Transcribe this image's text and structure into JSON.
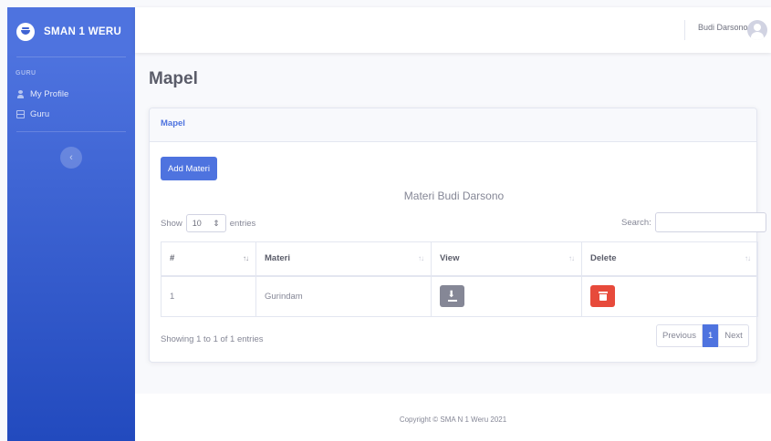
{
  "sidebar": {
    "brand": "SMAN 1 WERU",
    "heading": "GURU",
    "items": [
      {
        "label": "My Profile",
        "icon": "user-icon"
      },
      {
        "label": "Guru",
        "icon": "table-icon"
      }
    ],
    "toggle": "‹",
    "colors": {
      "top": "#4e73df",
      "bottom": "#224abe"
    }
  },
  "topbar": {
    "user_name": "Budi Darsono"
  },
  "page": {
    "title": "Mapel"
  },
  "card": {
    "header": "Mapel",
    "add_button": "Add Materi",
    "caption": "Materi Budi Darsono",
    "show_label": "Show",
    "show_value": "10",
    "entries_label": "entries",
    "search_label": "Search:",
    "search_value": "",
    "columns": [
      "#",
      "Materi",
      "View",
      "Delete"
    ],
    "rows": [
      {
        "no": "1",
        "materi": "Gurindam"
      }
    ],
    "info": "Showing 1 to 1 of 1 entries",
    "pagination": {
      "previous": "Previous",
      "current": "1",
      "next": "Next"
    }
  },
  "footer": {
    "text": "Copyright © SMA N 1 Weru 2021"
  },
  "colors": {
    "primary": "#4e73df",
    "danger": "#e74a3b",
    "secondary": "#858796"
  }
}
